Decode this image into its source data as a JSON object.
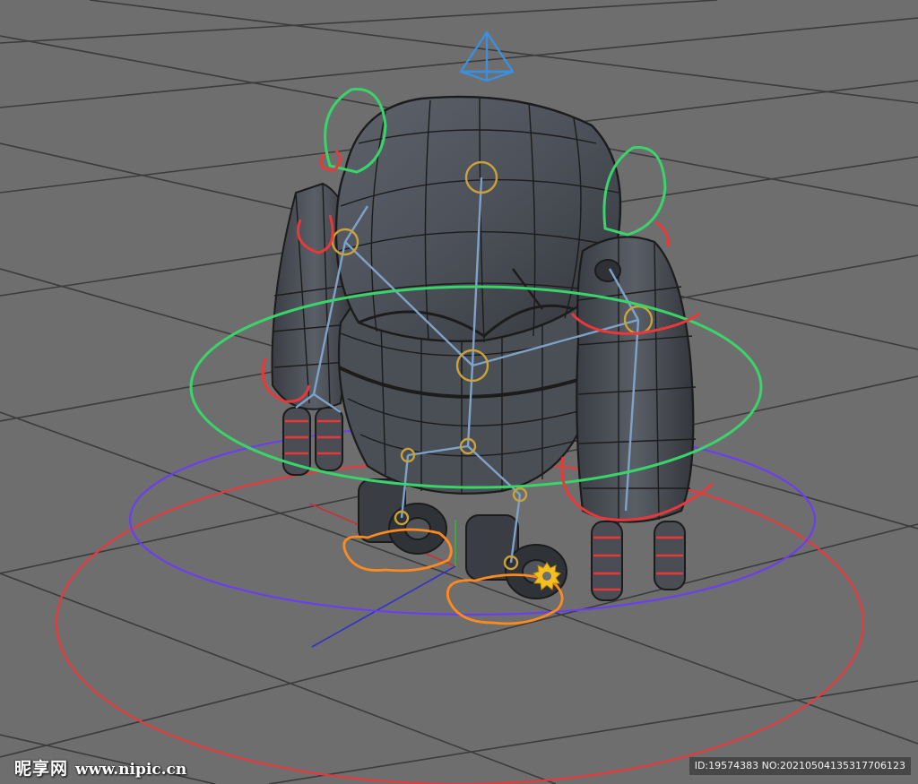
{
  "scene": {
    "background_color": "#6e6e6e",
    "grid_color": "#3c3c3c",
    "model_color": "#54585f",
    "model_edge_color": "#1c1c1c",
    "skeleton_color": "#7ea2c8",
    "joint_color": "#c9a23a",
    "controller_colors": {
      "outer_ring": "#e8393a",
      "mid_ring": "#6a3ff0",
      "body_ring": "#39d46a",
      "ear_loops": "#39d46a",
      "foot_loops": "#ff8a1e",
      "camera_icon": "#3a8fe0"
    },
    "axis_colors": {
      "x": "#c83232",
      "y": "#32b432",
      "z": "#3232c8"
    }
  },
  "watermark": {
    "site_name": "昵享网",
    "site_url": "www.nipic.cn",
    "image_info": "ID:19574383 NO:20210504135317706123"
  }
}
